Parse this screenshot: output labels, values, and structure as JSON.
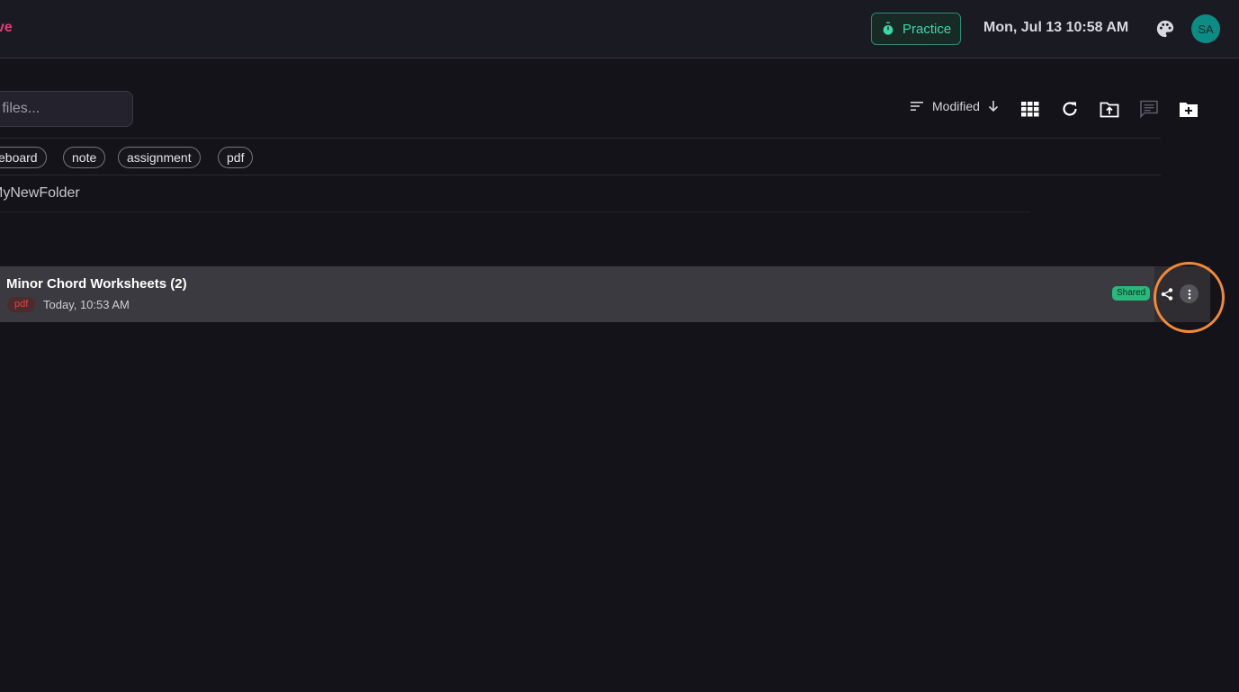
{
  "header": {
    "brand": "ve",
    "practice_label": "Practice",
    "datetime": "Mon, Jul 13 10:58 AM",
    "avatar_initials": "SA",
    "accent_color": "#3fd6a6",
    "brand_color": "#e23d78"
  },
  "search": {
    "value": "ch files..."
  },
  "toolbar": {
    "sort_label": "Modified",
    "icons": [
      "sort-icon",
      "arrow-down-icon",
      "grid-view-icon",
      "refresh-icon",
      "upload-folder-icon",
      "comment-icon",
      "new-folder-icon"
    ]
  },
  "tags": [
    "eboard",
    "note",
    "assignment",
    "pdf"
  ],
  "folder": {
    "name": "MyNewFolder"
  },
  "file": {
    "name": "Minor Chord Worksheets (2)",
    "type_badge": "pdf",
    "modified": "Today, 10:53 AM",
    "shared_label": "Shared"
  }
}
